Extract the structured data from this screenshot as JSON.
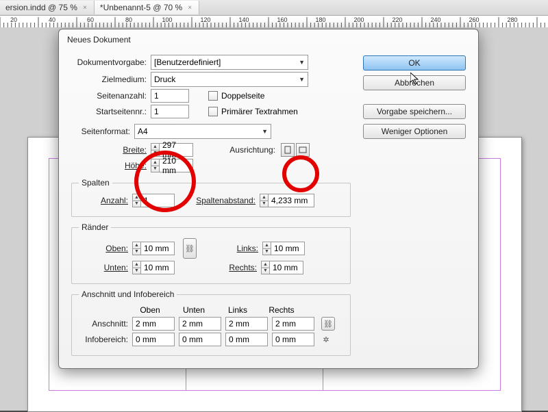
{
  "tabs": [
    {
      "label": "ersion.indd @ 75 %",
      "active": false
    },
    {
      "label": "*Unbenannt-5 @ 70 %",
      "active": true
    }
  ],
  "ruler_ticks": [
    "20",
    "40",
    "60",
    "80",
    "100",
    "120",
    "140",
    "160",
    "180",
    "200",
    "220",
    "240",
    "260",
    "280"
  ],
  "dialog": {
    "title": "Neues Dokument",
    "preset_label": "Dokumentvorgabe:",
    "preset_value": "[Benutzerdefiniert]",
    "intent_label": "Zielmedium:",
    "intent_value": "Druck",
    "pages_label": "Seitenanzahl:",
    "pages_value": "1",
    "startpage_label": "Startseitennr.:",
    "startpage_value": "1",
    "facing_label": "Doppelseite",
    "primarytxt_label": "Primärer Textrahmen",
    "size_label": "Seitenformat:",
    "size_value": "A4",
    "width_label": "Breite:",
    "width_value": "297 mm",
    "height_label": "Höhe:",
    "height_value": "210 mm",
    "orient_label": "Ausrichtung:",
    "columns": {
      "legend": "Spalten",
      "count_label": "Anzahl:",
      "count_value": "1",
      "gutter_label": "Spaltenabstand:",
      "gutter_value": "4,233 mm"
    },
    "margins": {
      "legend": "Ränder",
      "top_label": "Oben:",
      "top_value": "10 mm",
      "bottom_label": "Unten:",
      "bottom_value": "10 mm",
      "left_label": "Links:",
      "left_value": "10 mm",
      "right_label": "Rechts:",
      "right_value": "10 mm"
    },
    "bleed": {
      "legend": "Anschnitt und Infobereich",
      "col_top": "Oben",
      "col_bottom": "Unten",
      "col_left": "Links",
      "col_right": "Rechts",
      "bleed_label": "Anschnitt:",
      "bleed_top": "2 mm",
      "bleed_bottom": "2 mm",
      "bleed_left": "2 mm",
      "bleed_right": "2 mm",
      "slug_label": "Infobereich:",
      "slug_top": "0 mm",
      "slug_bottom": "0 mm",
      "slug_left": "0 mm",
      "slug_right": "0 mm"
    },
    "buttons": {
      "ok": "OK",
      "cancel": "Abbrechen",
      "save": "Vorgabe speichern...",
      "less": "Weniger Optionen"
    }
  }
}
